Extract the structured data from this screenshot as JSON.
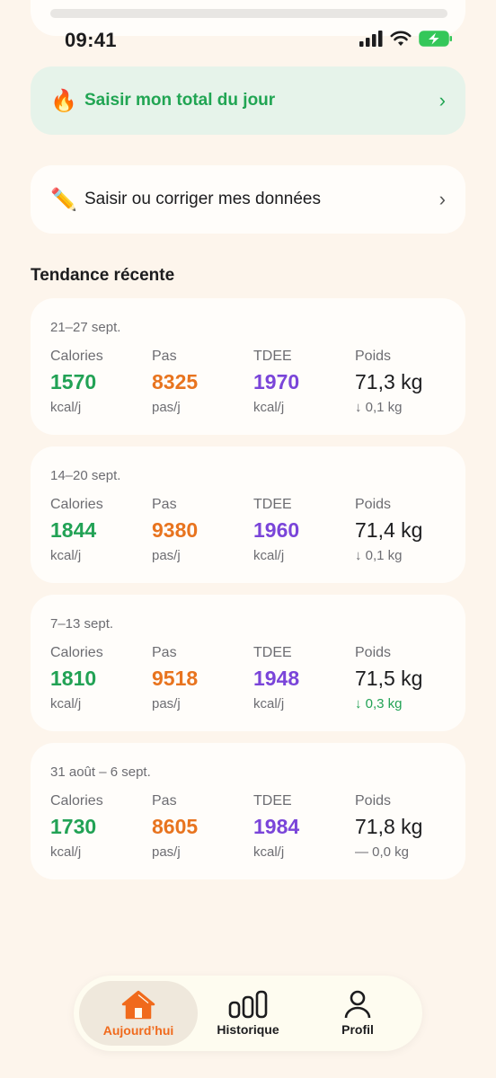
{
  "status_bar": {
    "time": "09:41"
  },
  "actions": {
    "primary": {
      "emoji": "🔥",
      "label": "Saisir mon total du jour",
      "chevron": "›"
    },
    "secondary": {
      "emoji": "✏️",
      "label": "Saisir ou corriger mes données",
      "chevron": "›"
    }
  },
  "section_title": "Tendance récente",
  "weeks": [
    {
      "range": "21–27 sept.",
      "calories": {
        "label": "Calories",
        "value": "1570",
        "unit": "kcal/j"
      },
      "pas": {
        "label": "Pas",
        "value": "8325",
        "unit": "pas/j"
      },
      "tdee": {
        "label": "TDEE",
        "value": "1970",
        "unit": "kcal/j"
      },
      "poids": {
        "label": "Poids",
        "value": "71,3 kg",
        "delta": "↓ 0,1 kg"
      }
    },
    {
      "range": "14–20 sept.",
      "calories": {
        "label": "Calories",
        "value": "1844",
        "unit": "kcal/j"
      },
      "pas": {
        "label": "Pas",
        "value": "9380",
        "unit": "pas/j"
      },
      "tdee": {
        "label": "TDEE",
        "value": "1960",
        "unit": "kcal/j"
      },
      "poids": {
        "label": "Poids",
        "value": "71,4 kg",
        "delta": "↓ 0,1 kg"
      }
    },
    {
      "range": "7–13 sept.",
      "calories": {
        "label": "Calories",
        "value": "1810",
        "unit": "kcal/j"
      },
      "pas": {
        "label": "Pas",
        "value": "9518",
        "unit": "pas/j"
      },
      "tdee": {
        "label": "TDEE",
        "value": "1948",
        "unit": "kcal/j"
      },
      "poids": {
        "label": "Poids",
        "value": "71,5 kg",
        "delta": "↓ 0,3 kg"
      }
    },
    {
      "range": "31 août – 6 sept.",
      "calories": {
        "label": "Calories",
        "value": "1730",
        "unit": "kcal/j"
      },
      "pas": {
        "label": "Pas",
        "value": "8605",
        "unit": "pas/j"
      },
      "tdee": {
        "label": "TDEE",
        "value": "1984",
        "unit": "kcal/j"
      },
      "poids": {
        "label": "Poids",
        "value": "71,8 kg",
        "delta": "— 0,0 kg"
      }
    }
  ],
  "nav": {
    "items": [
      {
        "label": "Aujourd’hui",
        "icon": "home-icon",
        "active": true
      },
      {
        "label": "Historique",
        "icon": "bar-chart-icon",
        "active": false
      },
      {
        "label": "Profil",
        "icon": "person-icon",
        "active": false
      }
    ]
  },
  "colors": {
    "calories": "#22a255",
    "pas": "#e8741f",
    "tdee": "#7a45d9",
    "accent": "#f06a1c",
    "background": "#fdf5ec"
  }
}
